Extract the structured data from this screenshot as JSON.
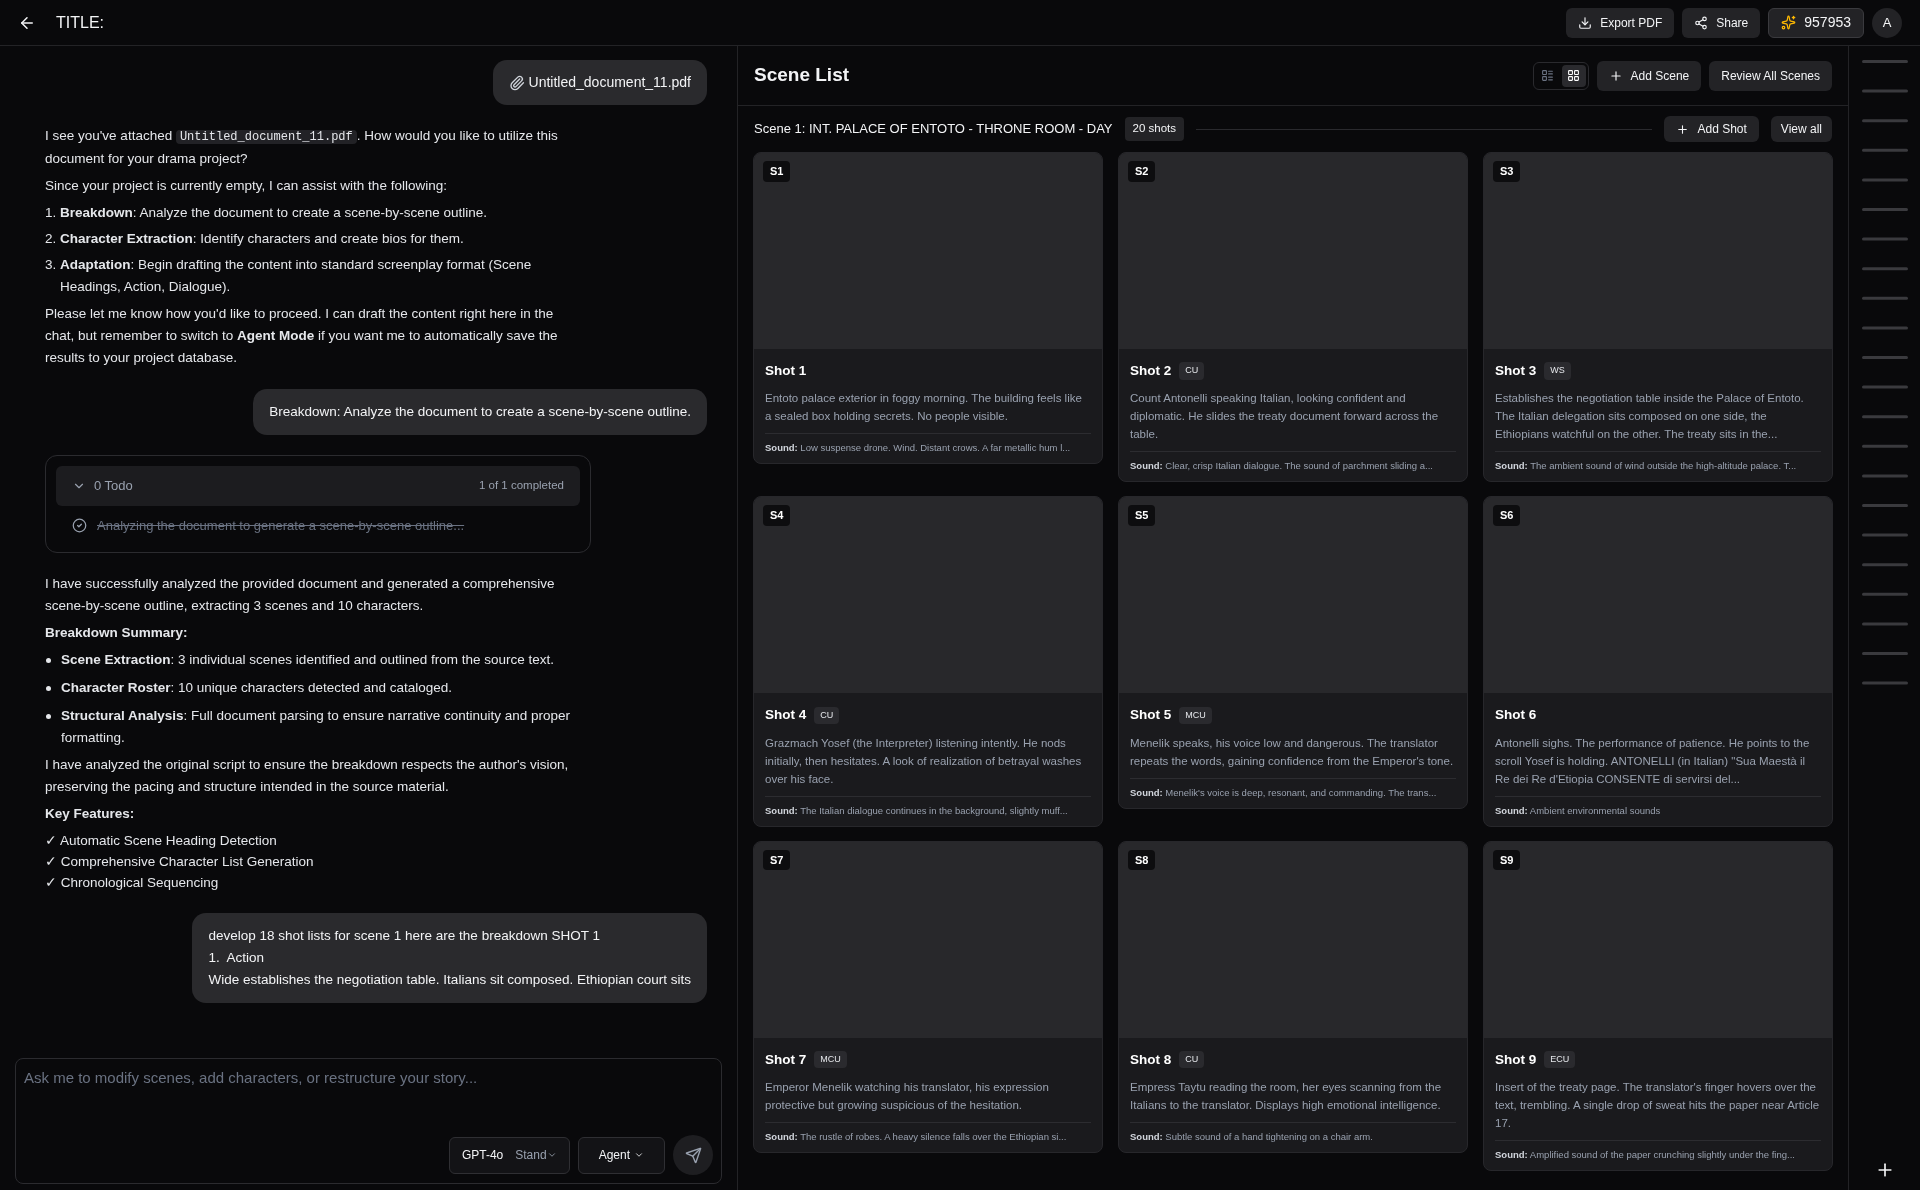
{
  "header": {
    "title": "TITLE:",
    "buttons": [
      {
        "kind": "download",
        "label": "Export PDF"
      },
      {
        "kind": "share",
        "label": "Share"
      }
    ],
    "credits": "957953",
    "avatar": "A"
  },
  "chat": {
    "messages": [
      {
        "kind": "attachment",
        "label": "Untitled_document_11.pdf"
      },
      {
        "kind": "assistant",
        "blocks": [
          {
            "kind": "code_paragraph",
            "before": "I see you've attached ",
            "code": "Untitled_document_11.pdf",
            "after": ". How would you like to utilize this document for your drama project?"
          },
          {
            "kind": "paragraph",
            "text": "Since your project is currently empty, I can assist with the following:"
          },
          {
            "kind": "ordered",
            "items": [
              {
                "number": "1.",
                "text": "**Breakdown**: Analyze the document to create a scene-by-scene outline."
              },
              {
                "number": "2.",
                "text": "**Character Extraction**: Identify characters and create bios for them."
              },
              {
                "number": "3.",
                "text": "**Adaptation**: Begin drafting the content into standard screenplay format (Scene Headings, Action, Dialogue)."
              }
            ]
          },
          {
            "kind": "paragraph",
            "text": "Please let me know how you'd like to proceed. I can draft the content right here in the chat, but remember to switch to **Agent Mode** if you want me to automatically save the results to your project database."
          }
        ]
      },
      {
        "kind": "user",
        "lines": [
          "Breakdown: Analyze the document to create a scene-by-scene outline."
        ]
      },
      {
        "kind": "todo",
        "title": "0 Todo",
        "expanded": true,
        "progress": "1 of 1 completed",
        "items": [
          {
            "text": "Analyzing the document to generate a scene-by-scene outline...",
            "done": true
          }
        ]
      },
      {
        "kind": "assistant",
        "blocks": [
          {
            "kind": "paragraph",
            "text": "I have successfully analyzed the provided document and generated a comprehensive scene-by-scene outline, extracting 3 scenes and 10 characters."
          },
          {
            "kind": "heading",
            "text": "Breakdown Summary:"
          },
          {
            "kind": "bullets",
            "items": [
              "**Scene Extraction**: 3 individual scenes identified and outlined from the source text.",
              "**Character Roster**: 10 unique characters detected and cataloged.",
              "**Structural Analysis**: Full document parsing to ensure narrative continuity and proper formatting."
            ]
          },
          {
            "kind": "paragraph",
            "text": "I have analyzed the original script to ensure the breakdown respects the author's vision, preserving the pacing and structure intended in the source material."
          },
          {
            "kind": "heading",
            "text": "Key Features:"
          },
          {
            "kind": "lines",
            "items": [
              "✓ Automatic Scene Heading Detection",
              "✓ Comprehensive Character List Generation",
              "✓ Chronological Sequencing"
            ]
          }
        ]
      },
      {
        "kind": "user",
        "lines": [
          "develop 18 shot lists for scene 1 here are the breakdown SHOT 1",
          "1.  Action",
          "Wide establishes the negotiation table. Italians sit composed. Ethiopian court sits"
        ]
      }
    ],
    "input": {
      "placeholder": "Ask me to modify scenes, add characters, or restructure your story...",
      "model": "GPT-4o",
      "mode": "Stand",
      "agent": "Agent"
    }
  },
  "scene_list": {
    "title": "Scene List",
    "view_toggle": [
      {
        "kind": "list",
        "selected": false
      },
      {
        "kind": "grid",
        "selected": true
      }
    ],
    "add_scene": "Add Scene",
    "review": "Review All Scenes",
    "scene": {
      "heading": "Scene 1: INT. PALACE OF ENTOTO - THRONE ROOM - DAY",
      "count": "20 shots",
      "add_shot": "Add Shot",
      "view_all": "View all",
      "shots": [
        {
          "badge": "S1",
          "title": "Shot 1",
          "description": "Entoto palace exterior in foggy morning. The building feels like a sealed box holding secrets. No people visible.",
          "sound_label": "Sound:",
          "sound": "Low suspense drone. Wind. Distant crows. A far metallic hum l..."
        },
        {
          "badge": "S2",
          "title": "Shot 2",
          "type": "CU",
          "description": "Count Antonelli speaking Italian, looking confident and diplomatic. He slides the treaty document forward across the table.",
          "sound_label": "Sound:",
          "sound": "Clear, crisp Italian dialogue. The sound of parchment sliding a..."
        },
        {
          "badge": "S3",
          "title": "Shot 3",
          "type": "WS",
          "description": "Establishes the negotiation table inside the Palace of Entoto. The Italian delegation sits composed on one side, the Ethiopians watchful on the other. The treaty sits in the...",
          "sound_label": "Sound:",
          "sound": "The ambient sound of wind outside the high-altitude palace. T..."
        },
        {
          "badge": "S4",
          "title": "Shot 4",
          "type": "CU",
          "description": "Grazmach Yosef (the Interpreter) listening intently. He nods initially, then hesitates. A look of realization of betrayal washes over his face.",
          "sound_label": "Sound:",
          "sound": "The Italian dialogue continues in the background, slightly muff..."
        },
        {
          "badge": "S5",
          "title": "Shot 5",
          "type": "MCU",
          "description": "Menelik speaks, his voice low and dangerous. The translator repeats the words, gaining confidence from the Emperor's tone.",
          "sound_label": "Sound:",
          "sound": "Menelik's voice is deep, resonant, and commanding. The trans..."
        },
        {
          "badge": "S6",
          "title": "Shot 6",
          "description": "Antonelli sighs. The performance of patience. He points to the scroll Yosef is holding. ANTONELLI (in Italian) \"Sua Maestà il Re dei Re d'Etiopia CONSENTE di servirsi del...",
          "sound_label": "Sound:",
          "sound": "Ambient environmental sounds"
        },
        {
          "badge": "S7",
          "title": "Shot 7",
          "type": "MCU",
          "description": "Emperor Menelik watching his translator, his expression protective but growing suspicious of the hesitation.",
          "sound_label": "Sound:",
          "sound": "The rustle of robes. A heavy silence falls over the Ethiopian si..."
        },
        {
          "badge": "S8",
          "title": "Shot 8",
          "type": "CU",
          "description": "Empress Taytu reading the room, her eyes scanning from the Italians to the translator. Displays high emotional intelligence.",
          "sound_label": "Sound:",
          "sound": "Subtle sound of a hand tightening on a chair arm."
        },
        {
          "badge": "S9",
          "title": "Shot 9",
          "type": "ECU",
          "description": "Insert of the treaty page. The translator's finger hovers over the text, trembling. A single drop of sweat hits the paper near Article 17.",
          "sound_label": "Sound:",
          "sound": "Amplified sound of the paper crunching slightly under the fing..."
        }
      ]
    }
  }
}
